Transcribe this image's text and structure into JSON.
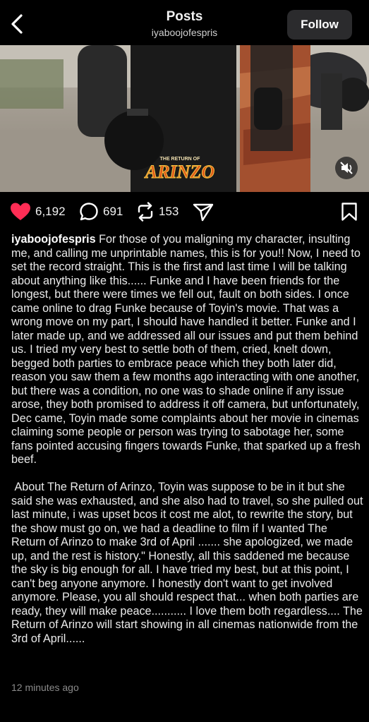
{
  "header": {
    "title": "Posts",
    "subtitle": "iyaboojofespris",
    "follow_label": "Follow"
  },
  "media": {
    "logo_line1": "THE RETURN OF",
    "logo_line2": "ARINZO",
    "mute_icon": "speaker-muted-icon"
  },
  "actions": {
    "likes": "6,192",
    "comments": "691",
    "reposts": "153"
  },
  "post": {
    "username": "iyaboojofespris",
    "text": " For those of you maligning my character, insulting me, and calling me unprintable names, this is for you!! Now, I need to set the record straight. This is the first and last time I will be talking about anything like this...... Funke and I have been friends for the longest, but there were times we fell out, fault on both sides. I once came online to drag Funke because of Toyin's movie. That was a wrong move on my part, I should have handled it better. Funke and I later made up, and we addressed all our issues and put them behind us. I tried my very best to settle both of them, cried, knelt down, begged both parties to embrace peace which they both later did, reason you saw them a few months ago interacting with one another, but there was a condition, no one was to shade online if any issue arose, they both promised to address it off camera, but unfortunately, Dec came, Toyin made some complaints about her movie in cinemas claiming some people or person was trying to sabotage her, some fans pointed accusing fingers towards Funke, that sparked up a fresh beef.\n\n About The Return of Arinzo, Toyin was suppose to be in it but she said she was exhausted, and she also had to travel, so she pulled out last minute, i was upset bcos it cost me alot, to rewrite the story, but the show must go on, we had a deadline to film if I wanted The Return of Arinzo to make 3rd of April ....... she apologized, we made up, and the rest is history.\" Honestly, all this saddened me because the sky is big enough for all. I have tried my best, but at this point, I can't beg anyone anymore. I honestly don't want to get involved anymore. Please, you all should respect that... when both parties are ready, they will make peace........... I love them both regardless.... The Return of Arinzo will start showing in all cinemas nationwide from the 3rd of April......",
    "timestamp": "12 minutes ago"
  },
  "colors": {
    "like": "#ff2d55",
    "background": "#000000",
    "follow_bg": "#2b2b2d"
  }
}
